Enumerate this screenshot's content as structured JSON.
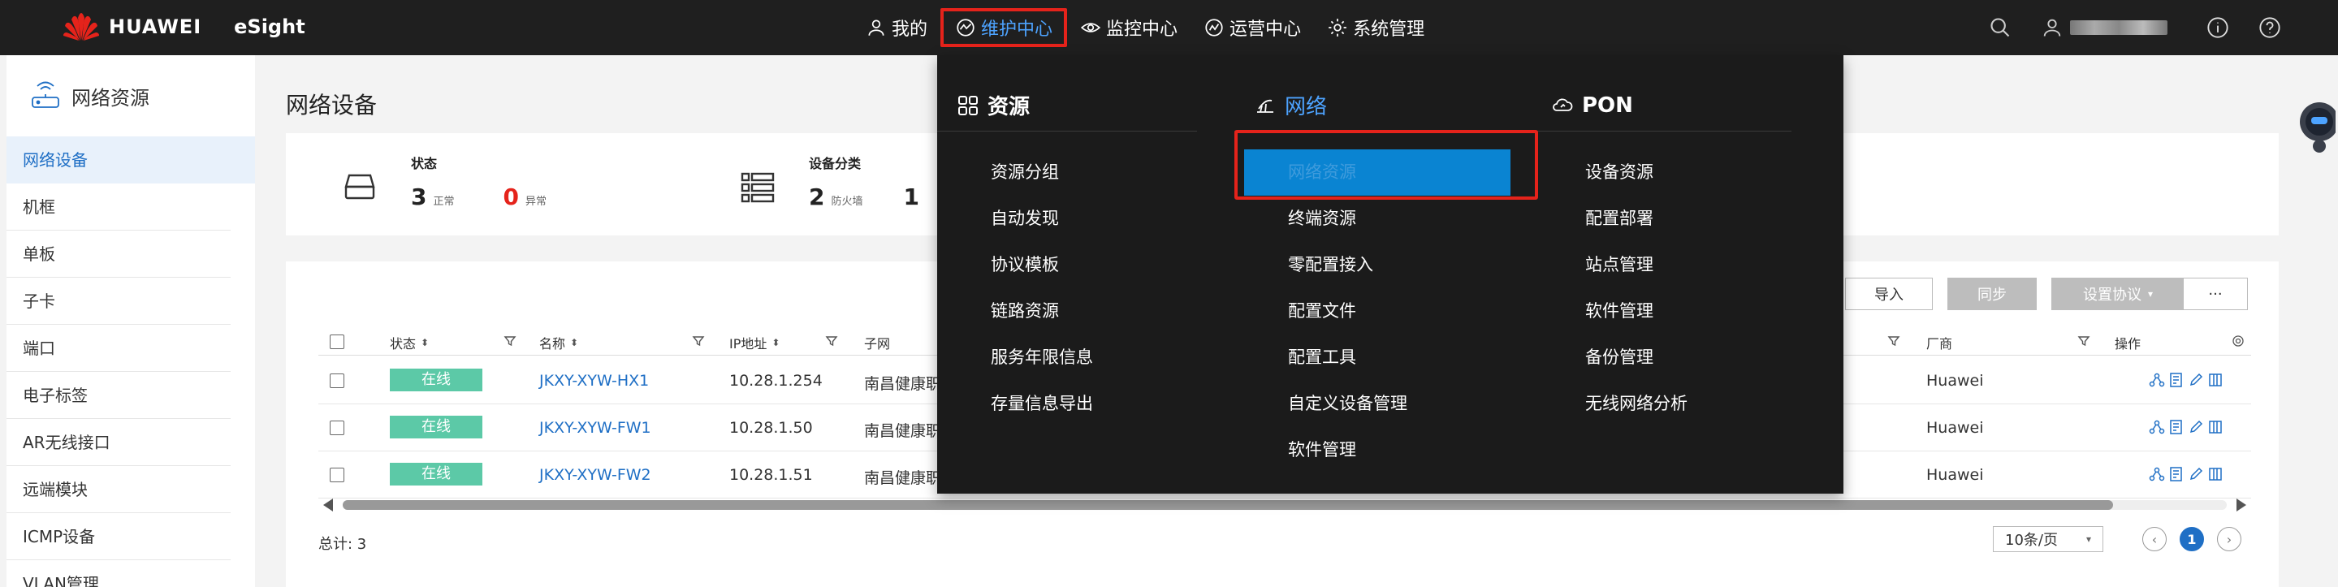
{
  "brand": {
    "name": "HUAWEI",
    "app": "eSight"
  },
  "nav": {
    "items": [
      {
        "label": "我的",
        "icon": "user-icon",
        "active": false
      },
      {
        "label": "维护中心",
        "icon": "maintenance-icon",
        "active": true
      },
      {
        "label": "监控中心",
        "icon": "eye-icon",
        "active": false
      },
      {
        "label": "运营中心",
        "icon": "operations-icon",
        "active": false
      },
      {
        "label": "系统管理",
        "icon": "gear-icon",
        "active": false
      }
    ]
  },
  "sidebar": {
    "title": "网络资源",
    "items": [
      "网络设备",
      "机框",
      "单板",
      "子卡",
      "端口",
      "电子标签",
      "AR无线接口",
      "远端模块",
      "ICMP设备",
      "VLAN管理"
    ],
    "active_index": 0
  },
  "page": {
    "title": "网络设备"
  },
  "summary": {
    "status_label": "状态",
    "normal_count": "3",
    "normal_label": "正常",
    "abnormal_count": "0",
    "abnormal_label": "异常",
    "category_label": "设备分类",
    "firewall_count": "2",
    "firewall_label": "防火墙",
    "other_count": "1"
  },
  "toolbar": {
    "import": "导入",
    "sync": "同步",
    "set_protocol": "设置协议",
    "more": "···"
  },
  "table": {
    "headers": {
      "status": "状态",
      "name": "名称",
      "ip": "IP地址",
      "subnet": "子网",
      "vendor": "厂商",
      "ops": "操作"
    },
    "rows": [
      {
        "status": "在线",
        "name": "JKXY-XYW-HX1",
        "ip": "10.28.1.254",
        "subnet": "南昌健康职",
        "vendor": "Huawei"
      },
      {
        "status": "在线",
        "name": "JKXY-XYW-FW1",
        "ip": "10.28.1.50",
        "subnet": "南昌健康职",
        "vendor": "Huawei"
      },
      {
        "status": "在线",
        "name": "JKXY-XYW-FW2",
        "ip": "10.28.1.51",
        "subnet": "南昌健康职",
        "vendor": "Huawei"
      }
    ]
  },
  "footer": {
    "total": "总计: 3",
    "page_size": "10条/页",
    "current_page": "1"
  },
  "mega_menu": {
    "columns": [
      {
        "title": "资源",
        "icon": "grid-icon",
        "items": [
          "资源分组",
          "自动发现",
          "协议模板",
          "链路资源",
          "服务年限信息",
          "存量信息导出"
        ]
      },
      {
        "title": "网络",
        "icon": "network-icon",
        "items": [
          "网络资源",
          "终端资源",
          "零配置接入",
          "配置文件",
          "配置工具",
          "自定义设备管理",
          "软件管理"
        ]
      },
      {
        "title": "PON",
        "icon": "cloud-icon",
        "items": [
          "设备资源",
          "配置部署",
          "站点管理",
          "软件管理",
          "备份管理",
          "无线网络分析"
        ]
      }
    ]
  },
  "colors": {
    "accent": "#1f6fc5",
    "highlight": "#0a84d2",
    "alert": "#e5231b",
    "online": "#5cc9a7",
    "topbar": "#1f1f1f"
  }
}
